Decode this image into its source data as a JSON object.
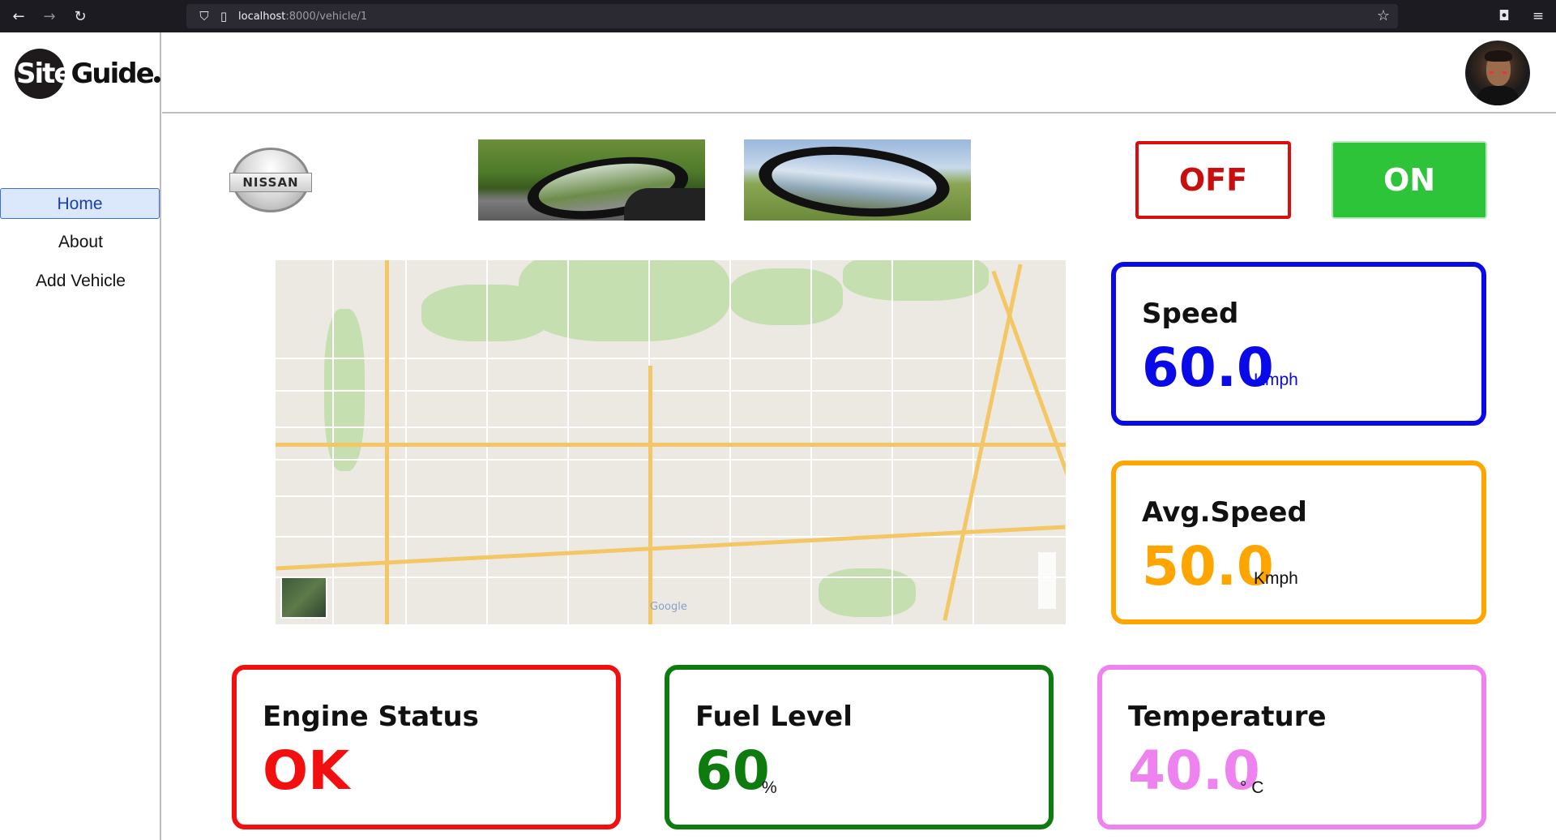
{
  "browser": {
    "url_host": "localhost",
    "url_path": ":8000/vehicle/1",
    "back_icon": "←",
    "forward_icon": "→",
    "reload_icon": "↻",
    "shield_icon": "⛉",
    "page_icon": "▯",
    "star_icon": "☆",
    "pocket_icon": "◘",
    "menu_icon": "≡"
  },
  "logo": {
    "part1": "Site",
    "part2": "Guide"
  },
  "sidebar": {
    "items": [
      {
        "label": "Home",
        "active": true
      },
      {
        "label": "About",
        "active": false
      },
      {
        "label": "Add Vehicle",
        "active": false
      }
    ]
  },
  "brand": {
    "name": "NISSAN"
  },
  "controls": {
    "off_label": "OFF",
    "on_label": "ON",
    "off_color": "#c90e0e",
    "on_color": "#2ec43a"
  },
  "stats": {
    "speed": {
      "title": "Speed",
      "value": "60.0",
      "unit": "Kmph",
      "color": "#0a0ae8"
    },
    "avg_speed": {
      "title": "Avg.Speed",
      "value": "50.0",
      "unit": "Kmph",
      "color": "#ffa500"
    },
    "engine": {
      "title": "Engine Status",
      "value": "OK",
      "unit": "",
      "color": "#f20f0f"
    },
    "fuel": {
      "title": "Fuel Level",
      "value": "60",
      "unit": "%",
      "color": "#0e7b0e"
    },
    "temperature": {
      "title": "Temperature",
      "value": "40.0",
      "unit": "° C",
      "color": "#ee82ee"
    }
  },
  "map": {
    "attribution": "Google"
  }
}
